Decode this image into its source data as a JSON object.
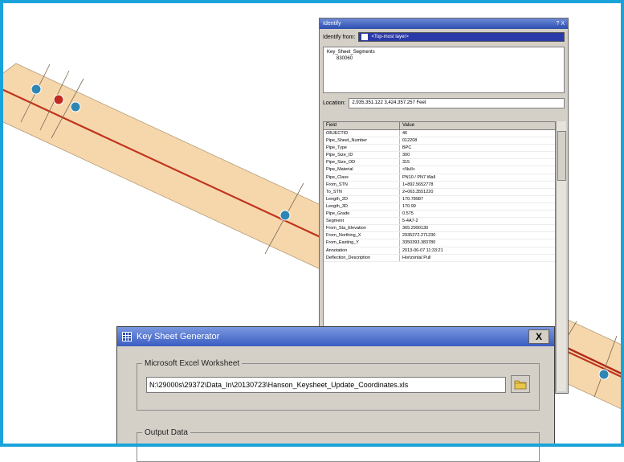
{
  "identify": {
    "title": "Identify",
    "title_controls": "? X",
    "identify_from_label": "Identify from:",
    "identify_from_value": "<Top-most layer>",
    "tree_layer": "Key_Sheet_Segments",
    "tree_feature": "830060",
    "location_label": "Location:",
    "location_value": "2,935,351.122 3,424,357.257 Feet",
    "field_header": "Field",
    "value_header": "Value",
    "rows": [
      {
        "field": "OBJECTID",
        "value": "46"
      },
      {
        "field": "Pipe_Sheet_Number",
        "value": "012208"
      },
      {
        "field": "Pipe_Type",
        "value": "BPC"
      },
      {
        "field": "Pipe_Size_ID",
        "value": "300"
      },
      {
        "field": "Pipe_Size_OD",
        "value": "315"
      },
      {
        "field": "Pipe_Material",
        "value": "<Null>"
      },
      {
        "field": "Pipe_Class",
        "value": "PN10 / PN7 Wall"
      },
      {
        "field": "From_STN",
        "value": "1+892.5652778"
      },
      {
        "field": "To_STN",
        "value": "2+063.3551220"
      },
      {
        "field": "Length_2D",
        "value": "170.78987"
      },
      {
        "field": "Length_3D",
        "value": "170.99"
      },
      {
        "field": "Pipe_Grade",
        "value": "0.575"
      },
      {
        "field": "Segment",
        "value": "5-4A7-2"
      },
      {
        "field": "From_Sta_Elevation",
        "value": "365.2990130"
      },
      {
        "field": "From_Northing_X",
        "value": "2935272.271230"
      },
      {
        "field": "From_Easting_Y",
        "value": "3350393.383780"
      },
      {
        "field": "Annotation",
        "value": "2013-06-07 11:33:21"
      },
      {
        "field": "Deflection_Description",
        "value": "Horizontal Pull"
      }
    ]
  },
  "dialog": {
    "title": "Key Sheet Generator",
    "close_label": "X",
    "excel_group_label": "Microsoft Excel Worksheet",
    "excel_path": "N:\\29000s\\29372\\Data_In\\20130723\\Hanson_Keysheet_Update_Coordinates.xls",
    "output_group_label": "Output Data"
  },
  "colors": {
    "frame": "#1aa3d9",
    "pipe_band": "#f6d7ac",
    "pipe_line": "#c0341d",
    "node": "#2e86b5",
    "node_selected": "#c02a20"
  }
}
